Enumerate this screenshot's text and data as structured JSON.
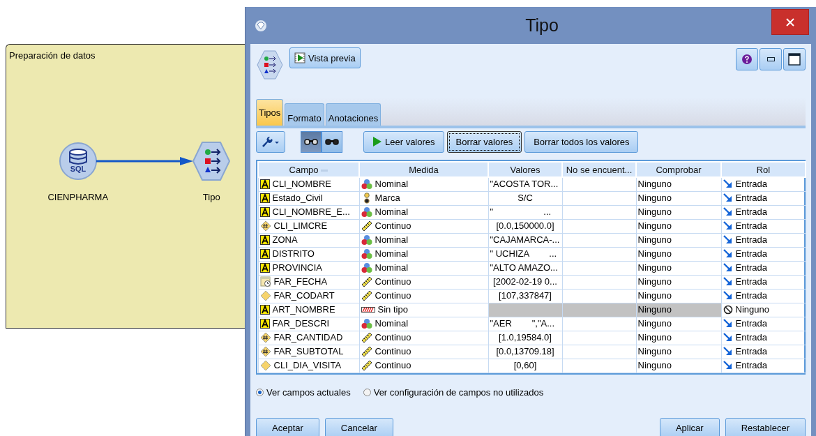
{
  "canvas": {
    "title": "Preparación de datos",
    "nodes": [
      {
        "kind": "database",
        "icon_text": "SQL",
        "label": "CIENPHARMA"
      },
      {
        "kind": "type",
        "label": "Tipo"
      }
    ]
  },
  "dialog": {
    "title": "Tipo",
    "preview_button": "Vista previa",
    "tabs": [
      {
        "label": "Tipos",
        "selected": true
      },
      {
        "label": "Formato",
        "selected": false
      },
      {
        "label": "Anotaciones",
        "selected": false
      }
    ],
    "view_toggles": [
      {
        "selected": true
      },
      {
        "selected": false
      }
    ],
    "actions": [
      {
        "label": "Leer valores",
        "kind": "play",
        "focused": false
      },
      {
        "label": "Borrar valores",
        "kind": "plain",
        "focused": true
      },
      {
        "label": "Borrar todos los valores",
        "kind": "plain",
        "focused": false
      }
    ],
    "table": {
      "columns": [
        "Campo",
        "Medida",
        "Valores",
        "No se encuent...",
        "Comprobar",
        "Rol"
      ],
      "rows": [
        {
          "field": {
            "name": "CLI_NOMBRE",
            "kind": "string"
          },
          "measure": {
            "label": "Nominal",
            "kind": "nominal"
          },
          "values": "\"ACOSTA TOR...",
          "check": "Ninguno",
          "role": {
            "label": "Entrada",
            "kind": "input"
          },
          "disabled": false
        },
        {
          "field": {
            "name": "Estado_Civil",
            "kind": "string"
          },
          "measure": {
            "label": "Marca",
            "kind": "flag"
          },
          "values": "S/C",
          "check": "Ninguno",
          "role": {
            "label": "Entrada",
            "kind": "input"
          },
          "disabled": false
        },
        {
          "field": {
            "name": "CLI_NOMBRE_E...",
            "kind": "string"
          },
          "measure": {
            "label": "Nominal",
            "kind": "nominal"
          },
          "values": "\"                    ...",
          "check": "Ninguno",
          "role": {
            "label": "Entrada",
            "kind": "input"
          },
          "disabled": false
        },
        {
          "field": {
            "name": "CLI_LIMCRE",
            "kind": "real"
          },
          "measure": {
            "label": "Continuo",
            "kind": "continuous"
          },
          "values": "[0.0,150000.0]",
          "check": "Ninguno",
          "role": {
            "label": "Entrada",
            "kind": "input"
          },
          "disabled": false
        },
        {
          "field": {
            "name": "ZONA",
            "kind": "string"
          },
          "measure": {
            "label": "Nominal",
            "kind": "nominal"
          },
          "values": "\"CAJAMARCA-...",
          "check": "Ninguno",
          "role": {
            "label": "Entrada",
            "kind": "input"
          },
          "disabled": false
        },
        {
          "field": {
            "name": "DISTRITO",
            "kind": "string"
          },
          "measure": {
            "label": "Nominal",
            "kind": "nominal"
          },
          "values": "\" UCHIZA        ...",
          "check": "Ninguno",
          "role": {
            "label": "Entrada",
            "kind": "input"
          },
          "disabled": false
        },
        {
          "field": {
            "name": "PROVINCIA",
            "kind": "string"
          },
          "measure": {
            "label": "Nominal",
            "kind": "nominal"
          },
          "values": "\"ALTO AMAZO...",
          "check": "Ninguno",
          "role": {
            "label": "Entrada",
            "kind": "input"
          },
          "disabled": false
        },
        {
          "field": {
            "name": "FAR_FECHA",
            "kind": "date"
          },
          "measure": {
            "label": "Continuo",
            "kind": "continuous"
          },
          "values": "[2002-02-19 0...",
          "check": "Ninguno",
          "role": {
            "label": "Entrada",
            "kind": "input"
          },
          "disabled": false
        },
        {
          "field": {
            "name": "FAR_CODART",
            "kind": "integer"
          },
          "measure": {
            "label": "Continuo",
            "kind": "continuous"
          },
          "values": "[107,337847]",
          "check": "Ninguno",
          "role": {
            "label": "Entrada",
            "kind": "input"
          },
          "disabled": false
        },
        {
          "field": {
            "name": "ART_NOMBRE",
            "kind": "string"
          },
          "measure": {
            "label": "Sin tipo",
            "kind": "typeless"
          },
          "check": "Ninguno",
          "role": {
            "label": "Ninguno",
            "kind": "none"
          },
          "disabled": true
        },
        {
          "field": {
            "name": "FAR_DESCRI",
            "kind": "string"
          },
          "measure": {
            "label": "Nominal",
            "kind": "nominal"
          },
          "values": "\"AER        \",\"A...",
          "check": "Ninguno",
          "role": {
            "label": "Entrada",
            "kind": "input"
          },
          "disabled": false
        },
        {
          "field": {
            "name": "FAR_CANTIDAD",
            "kind": "real"
          },
          "measure": {
            "label": "Continuo",
            "kind": "continuous"
          },
          "values": "[1.0,19584.0]",
          "check": "Ninguno",
          "role": {
            "label": "Entrada",
            "kind": "input"
          },
          "disabled": false
        },
        {
          "field": {
            "name": "FAR_SUBTOTAL",
            "kind": "real"
          },
          "measure": {
            "label": "Continuo",
            "kind": "continuous"
          },
          "values": "[0.0,13709.18]",
          "check": "Ninguno",
          "role": {
            "label": "Entrada",
            "kind": "input"
          },
          "disabled": false
        },
        {
          "field": {
            "name": "CLI_DIA_VISITA",
            "kind": "integer"
          },
          "measure": {
            "label": "Continuo",
            "kind": "continuous"
          },
          "values": "[0,60]",
          "check": "Ninguno",
          "role": {
            "label": "Entrada",
            "kind": "input"
          },
          "disabled": false
        }
      ]
    },
    "view_options": [
      {
        "label": "Ver campos actuales",
        "selected": true
      },
      {
        "label": "Ver configuración de campos no utilizados",
        "selected": false
      }
    ],
    "left_buttons": [
      "Aceptar",
      "Cancelar"
    ],
    "right_buttons": [
      "Aplicar",
      "Restablecer"
    ]
  }
}
